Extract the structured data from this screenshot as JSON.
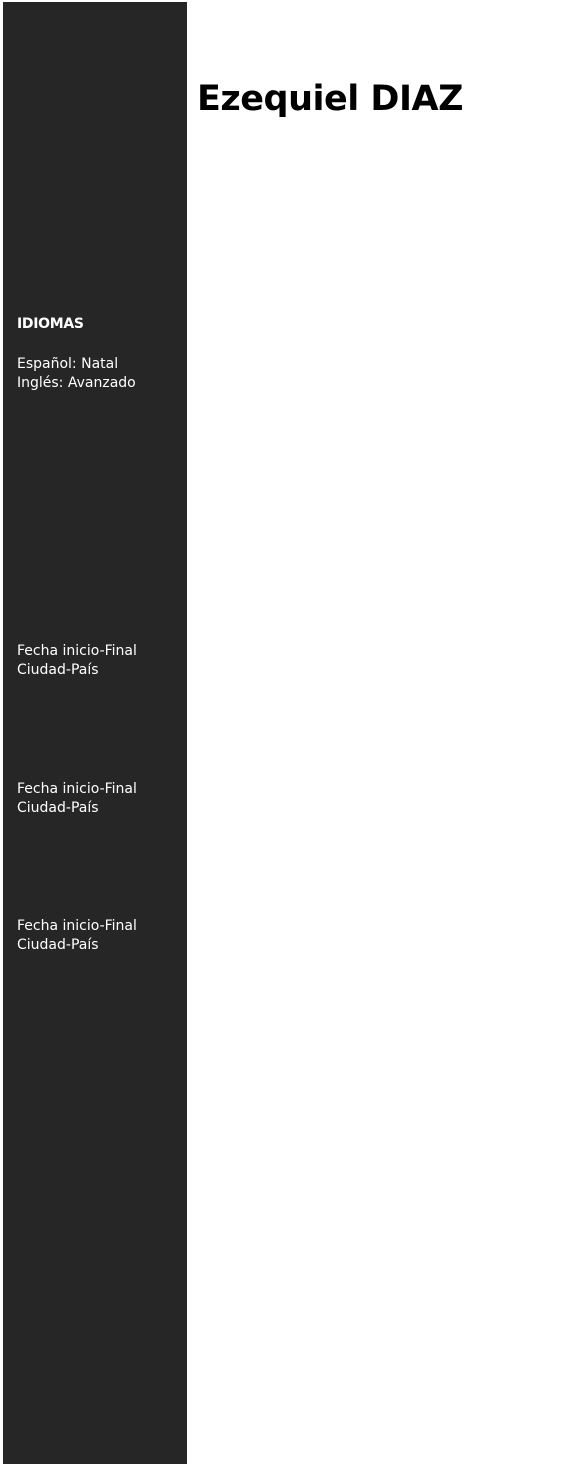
{
  "header": {
    "name": "Ezequiel DIAZ"
  },
  "sidebar": {
    "languages": {
      "heading": "IDIOMAS",
      "items": [
        "Español: Natal",
        "Inglés: Avanzado"
      ]
    },
    "entries": [
      {
        "dates": "Fecha inicio-Final",
        "location": "Ciudad-País"
      },
      {
        "dates": "Fecha inicio-Final",
        "location": "Ciudad-País"
      },
      {
        "dates": "Fecha inicio-Final",
        "location": "Ciudad-País"
      }
    ]
  },
  "colors": {
    "sidebar_background": "#262626",
    "sidebar_text": "#ffffff",
    "main_background": "#ffffff",
    "name_text": "#000000"
  }
}
